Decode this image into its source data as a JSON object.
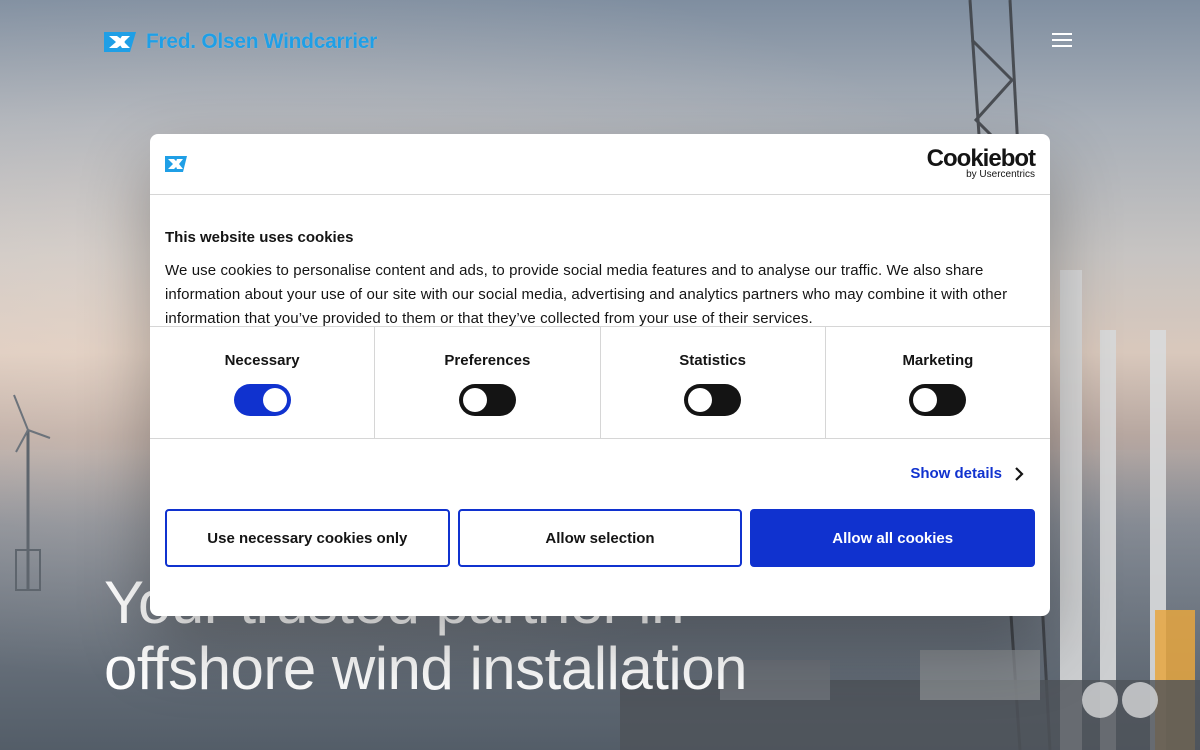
{
  "header": {
    "brand_name": "Fred. Olsen Windcarrier",
    "menu_icon": "hamburger-menu-icon"
  },
  "hero": {
    "title_line1": "Your trusted partner in",
    "title_line2": "offshore wind installation"
  },
  "cookie_dialog": {
    "provider_name": "Cookiebot",
    "provider_sub": "by Usercentrics",
    "heading": "This website uses cookies",
    "text": "We use cookies to personalise content and ads, to provide social media features and to analyse our traffic. We also share information about your use of our site with our social media, advertising and analytics partners who may combine it with other information that you’ve provided to them or that they’ve collected from your use of their services.",
    "categories": [
      {
        "label": "Necessary",
        "enabled": true
      },
      {
        "label": "Preferences",
        "enabled": false
      },
      {
        "label": "Statistics",
        "enabled": false
      },
      {
        "label": "Marketing",
        "enabled": false
      }
    ],
    "show_details_label": "Show details",
    "buttons": {
      "necessary_only": "Use necessary cookies only",
      "allow_selection": "Allow selection",
      "allow_all": "Allow all cookies"
    }
  },
  "colors": {
    "brand_blue": "#1f9fe6",
    "accent": "#1032cf",
    "toggle_off": "#141414"
  }
}
